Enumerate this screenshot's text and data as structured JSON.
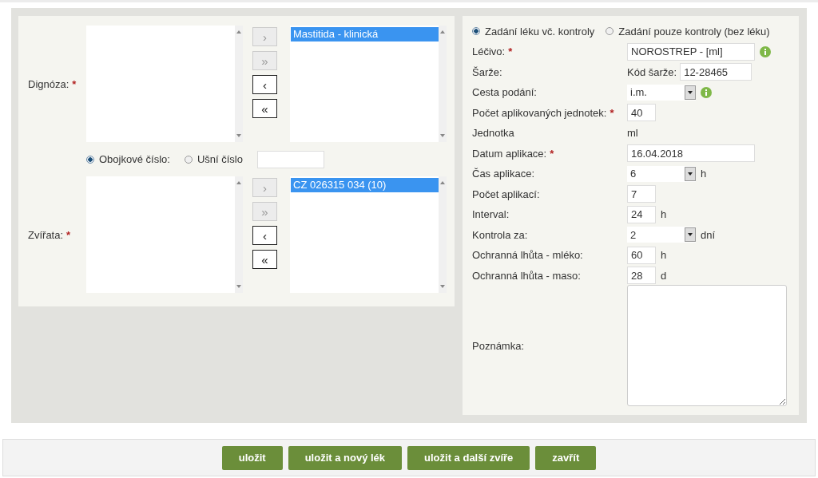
{
  "transfer_lists": [
    {
      "label": "Dignóza:",
      "required_mark": "*",
      "chosen": [
        {
          "text": "Mastitida - klinická",
          "selected": true
        }
      ],
      "buttons": [
        {
          "text": "›",
          "disabled": true
        },
        {
          "text": "»",
          "disabled": true
        },
        {
          "text": "‹",
          "disabled": false
        },
        {
          "text": "«",
          "disabled": false
        }
      ]
    },
    {
      "label": "Zvířata:",
      "required_mark": "*",
      "chosen": [
        {
          "text": "CZ 026315 034 (10)",
          "selected": true
        }
      ],
      "buttons": [
        {
          "text": "›",
          "disabled": true
        },
        {
          "text": "»",
          "disabled": true
        },
        {
          "text": "‹",
          "disabled": false
        },
        {
          "text": "«",
          "disabled": false
        }
      ]
    }
  ],
  "id_type": {
    "options": [
      {
        "label": "Obojkové číslo:",
        "selected": true
      },
      {
        "label": "Ušní číslo",
        "selected": false
      }
    ]
  },
  "mode_options": [
    {
      "label": "Zadání léku vč. kontroly",
      "selected": true
    },
    {
      "label": "Zadání pouze kontroly (bez léku)",
      "selected": false
    }
  ],
  "fields": [
    {
      "label": "Léčivo:",
      "required_mark": "*",
      "kind": "input",
      "value": "NOROSTREP - [ml]",
      "info": true
    },
    {
      "label": "Šarže:",
      "kind": "batch",
      "prefix": "Kód šarže:",
      "value": "12-28465"
    },
    {
      "label": "Cesta podání:",
      "kind": "select",
      "value": "i.m.",
      "info": true
    },
    {
      "label": "Počet aplikovaných jednotek:",
      "required_mark": "*",
      "kind": "short",
      "value": "40"
    },
    {
      "label": "Jednotka",
      "kind": "text",
      "value": "ml"
    },
    {
      "label": "Datum aplikace:",
      "required_mark": "*",
      "kind": "input",
      "value": "16.04.2018"
    },
    {
      "label": "Čas aplikace:",
      "kind": "select",
      "value": "6",
      "unit": "h"
    },
    {
      "label": "Počet aplikací:",
      "kind": "short",
      "value": "7"
    },
    {
      "label": "Interval:",
      "kind": "short",
      "value": "24",
      "unit": "h"
    },
    {
      "label": "Kontrola za:",
      "kind": "select",
      "value": "2",
      "unit": "dní"
    },
    {
      "label": "Ochranná lhůta - mléko:",
      "kind": "short",
      "value": "60",
      "unit": "h"
    },
    {
      "label": "Ochranná lhůta - maso:",
      "kind": "short",
      "value": "28",
      "unit": "d"
    },
    {
      "label": "Poznámka:",
      "kind": "textarea"
    }
  ],
  "buttons": [
    "uložit",
    "uložit a nový lék",
    "uložit a další zvíře",
    "zavřít"
  ]
}
